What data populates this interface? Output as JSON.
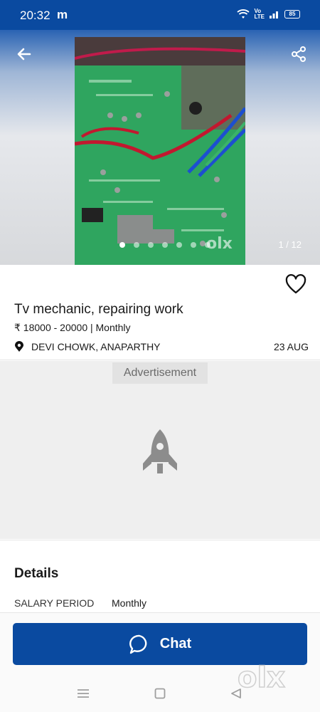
{
  "status_bar": {
    "time": "20:32",
    "app_indicator": "m",
    "battery": "85",
    "icons": [
      "wifi-icon",
      "volte-icon",
      "signal-icon",
      "battery-icon"
    ]
  },
  "gallery": {
    "counter": "1 / 12",
    "image_count": 12,
    "active_index": 0,
    "watermark": "olx"
  },
  "listing": {
    "title": "Tv mechanic, repairing work",
    "price": "₹ 18000 - 20000 | Monthly",
    "location": "DEVI CHOWK, ANAPARTHY",
    "date": "23 AUG"
  },
  "advertisement": {
    "label": "Advertisement"
  },
  "details": {
    "heading": "Details",
    "rows": [
      {
        "key": "SALARY PERIOD",
        "value": "Monthly"
      }
    ]
  },
  "chat": {
    "label": "Chat"
  },
  "colors": {
    "brand_blue": "#0a4aa0",
    "background_gray": "#efefef"
  }
}
